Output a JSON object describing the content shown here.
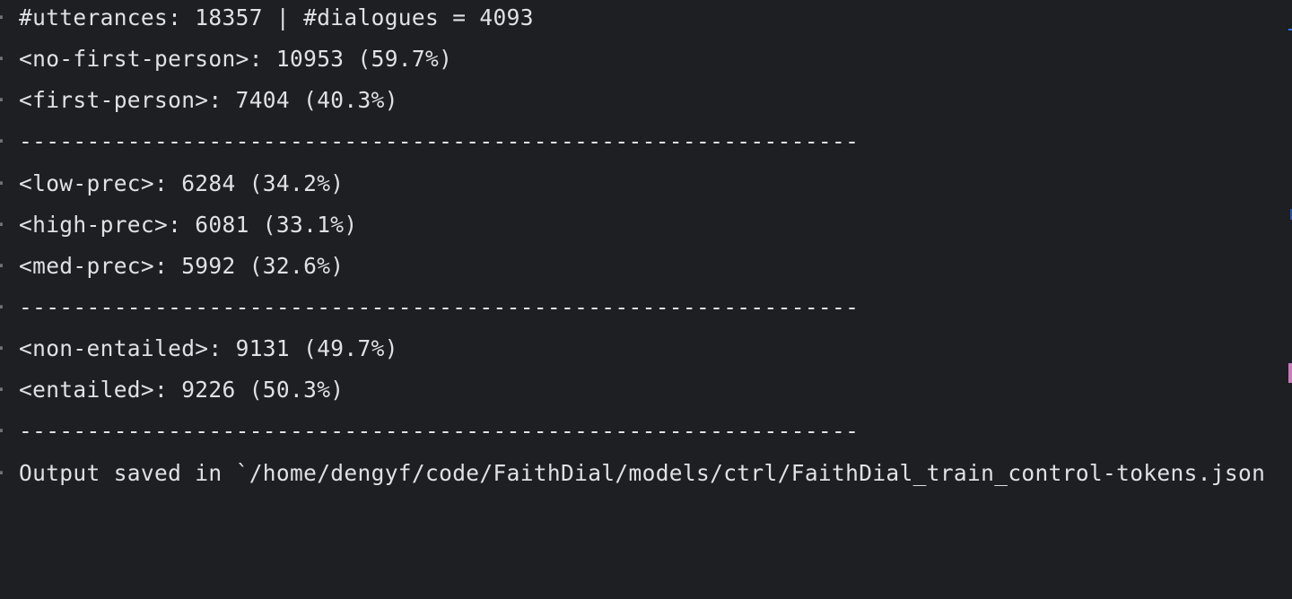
{
  "terminal": {
    "gutter_glyph": "·",
    "lines": [
      "#utterances: 18357 | #dialogues = 4093",
      "<no-first-person>: 10953 (59.7%)",
      "<first-person>: 7404 (40.3%)",
      "--------------------------------------------------------------",
      "<low-prec>: 6284 (34.2%)",
      "<high-prec>: 6081 (33.1%)",
      "<med-prec>: 5992 (32.6%)",
      "--------------------------------------------------------------",
      "<non-entailed>: 9131 (49.7%)",
      "<entailed>: 9226 (50.3%)",
      "--------------------------------------------------------------",
      "Output saved in `/home/dengyf/code/FaithDial/models/ctrl/FaithDial_train_control-tokens.json"
    ]
  },
  "colors": {
    "background": "#1e1f22",
    "text": "#dfe1e5",
    "gutter": "#6f737a",
    "marker_blue": "#3574f0",
    "marker_pink": "#c77dbb"
  }
}
